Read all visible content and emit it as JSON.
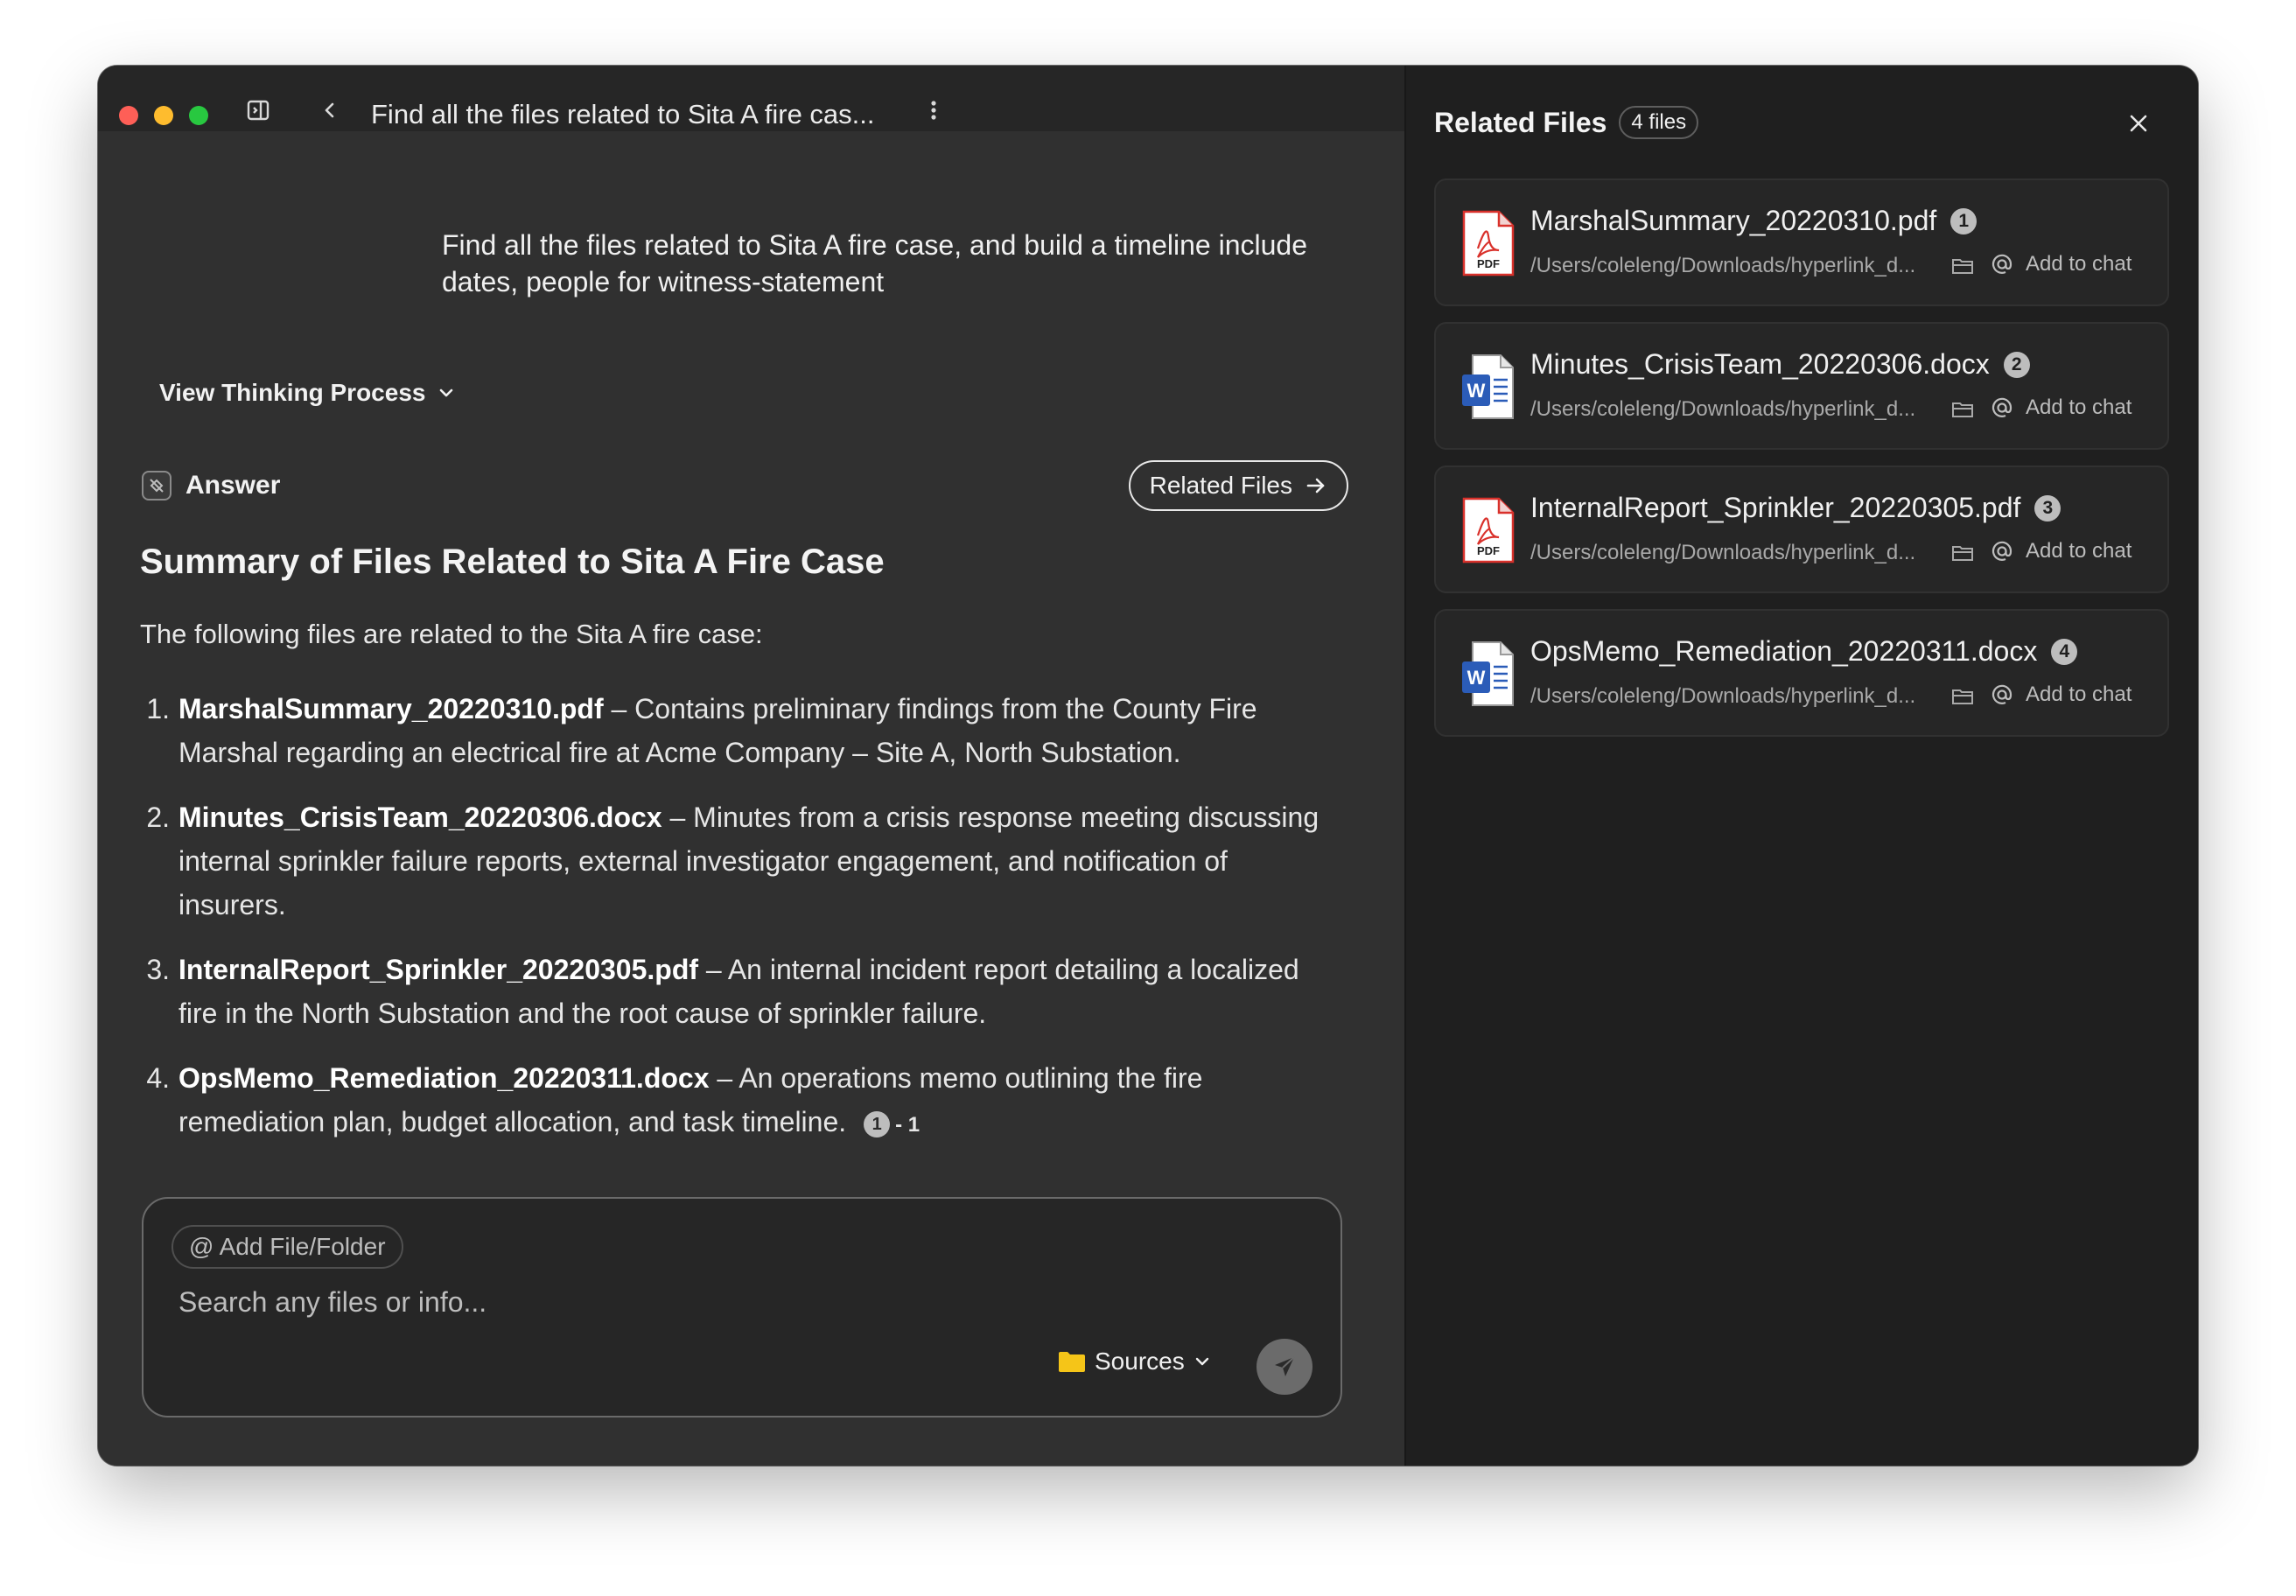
{
  "titlebar": {
    "thread_title": "Find all the files related to Sita A fire cas..."
  },
  "conversation": {
    "user_message": "Find all the files related to Sita A fire case, and build a timeline include dates, people for witness-statement",
    "thinking_label": "View Thinking Process",
    "answer_label": "Answer",
    "related_files_button": "Related Files",
    "summary_title": "Summary of Files Related to Sita A Fire Case",
    "intro": "The following files are related to the Sita A fire case:",
    "items": [
      {
        "num": "1.",
        "name": "MarshalSummary_20220310.pdf",
        "desc": " – Contains preliminary findings from the County Fire Marshal regarding an electrical fire at Acme Company – Site A, North Substation."
      },
      {
        "num": "2.",
        "name": "Minutes_CrisisTeam_20220306.docx",
        "desc": " – Minutes from a crisis response meeting discussing internal sprinkler failure reports, external investigator engagement, and notification of insurers."
      },
      {
        "num": "3.",
        "name": "InternalReport_Sprinkler_20220305.pdf",
        "desc": " – An internal incident report detailing a localized fire in the North Substation and the root cause of sprinkler failure."
      },
      {
        "num": "4.",
        "name": "OpsMemo_Remediation_20220311.docx",
        "desc": " – An operations memo outlining the fire remediation plan, budget allocation, and task timeline."
      }
    ],
    "citation": {
      "badge": "1",
      "suffix": "- 1"
    }
  },
  "composer": {
    "add_file_label": "@ Add File/Folder",
    "placeholder": "Search any files or info...",
    "sources_label": "Sources"
  },
  "related_files": {
    "title": "Related Files",
    "count": "4 files",
    "add_to_chat_label": "Add to chat",
    "files": [
      {
        "name": "MarshalSummary_20220310.pdf",
        "badge": "1",
        "path": "/Users/coleleng/Downloads/hyperlink_d...",
        "type": "pdf"
      },
      {
        "name": "Minutes_CrisisTeam_20220306.docx",
        "badge": "2",
        "path": "/Users/coleleng/Downloads/hyperlink_d...",
        "type": "docx"
      },
      {
        "name": "InternalReport_Sprinkler_20220305.pdf",
        "badge": "3",
        "path": "/Users/coleleng/Downloads/hyperlink_d...",
        "type": "pdf"
      },
      {
        "name": "OpsMemo_Remediation_20220311.docx",
        "badge": "4",
        "path": "/Users/coleleng/Downloads/hyperlink_d...",
        "type": "docx"
      }
    ]
  },
  "colors": {
    "chat_bg": "#303030",
    "files_bg": "#1f1f1f",
    "pdf_red": "#d9312b",
    "word_blue": "#2b5cb8",
    "sources_folder": "#f5c518"
  }
}
